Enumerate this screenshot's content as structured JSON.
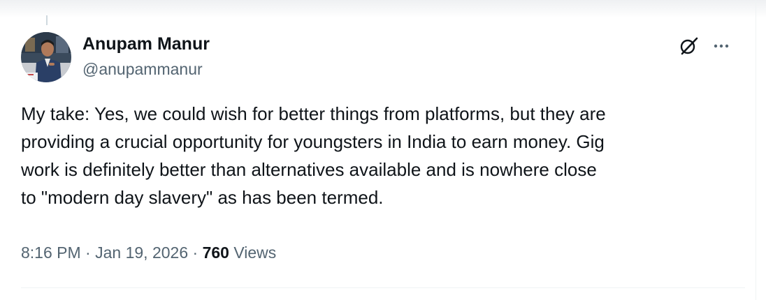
{
  "tweet": {
    "author": {
      "name": "Anupam Manur",
      "handle": "@anupammanur",
      "avatar_icon": "profile-photo"
    },
    "actions": {
      "grok_icon": "grok-icon",
      "more_icon": "more-options-icon"
    },
    "text_lines": [
      "My take: Yes, we could wish for better things from platforms, but they are",
      "providing a crucial opportunity for youngsters in India to earn money. Gig",
      "work is definitely better than alternatives available and is nowhere close",
      "to \"modern day slavery\" as has been termed."
    ],
    "time": "8:16 PM",
    "separator": "·",
    "date": "Jan 19, 2026",
    "views_count": "760",
    "views_label": "Views"
  },
  "colors": {
    "text_primary": "#0f1419",
    "text_secondary": "#536471",
    "border": "#eff3f4"
  }
}
